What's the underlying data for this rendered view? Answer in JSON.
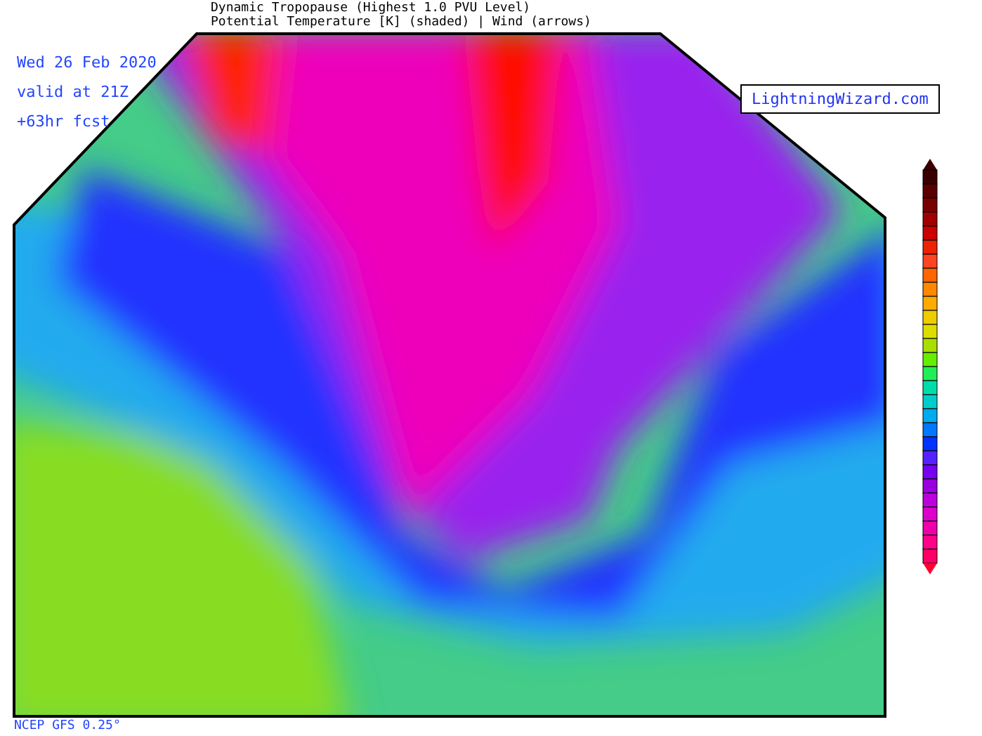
{
  "header": {
    "title": "Dynamic Tropopause (Highest 1.0 PVU Level)",
    "subtitle": "Potential Temperature [K] (shaded) | Wind (arrows)"
  },
  "run_info": [
    "Wed 26 Feb 2020",
    "valid at 21Z",
    "+63hr fcst"
  ],
  "logo": {
    "text": "LightningWizard.com"
  },
  "footer": {
    "source": "NCEP GFS 0.25°"
  }
}
